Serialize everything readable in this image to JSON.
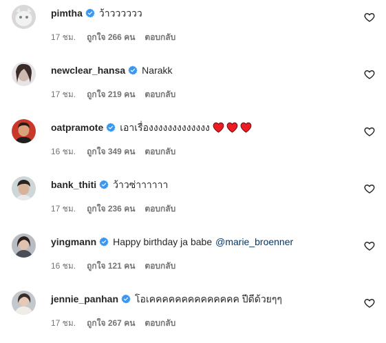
{
  "colors": {
    "text": "#262626",
    "muted": "#737373",
    "mention": "#00376b",
    "verified": "#3897f0",
    "heart": "#ed1c24"
  },
  "comments": [
    {
      "username": "pimtha",
      "text": "ว้าวววววว",
      "time": "17 ชม.",
      "likes": "ถูกใจ 266 คน",
      "reply": "ตอบกลับ"
    },
    {
      "username": "newclear_hansa",
      "text": "Narakk",
      "time": "17 ชม.",
      "likes": "ถูกใจ 219 คน",
      "reply": "ตอบกลับ"
    },
    {
      "username": "oatpramote",
      "text": "เอาเรื่องงงงงงงงงงงงง",
      "emoji": [
        "red-heart",
        "red-heart",
        "red-heart"
      ],
      "time": "16 ชม.",
      "likes": "ถูกใจ 349 คน",
      "reply": "ตอบกลับ"
    },
    {
      "username": "bank_thiti",
      "text": "ว้าวซ่าาาาาา",
      "time": "17 ชม.",
      "likes": "ถูกใจ 236 คน",
      "reply": "ตอบกลับ"
    },
    {
      "username": "yingmann",
      "text": "Happy birthday ja babe",
      "mention": "@marie_broenner",
      "time": "16 ชม.",
      "likes": "ถูกใจ 121 คน",
      "reply": "ตอบกลับ"
    },
    {
      "username": "jennie_panhan",
      "text": "โอเคคคคคคคคคคคคคค ปีดีด้วยๆๆ",
      "time": "17 ชม.",
      "likes": "ถูกใจ 267 คน",
      "reply": "ตอบกลับ"
    }
  ]
}
